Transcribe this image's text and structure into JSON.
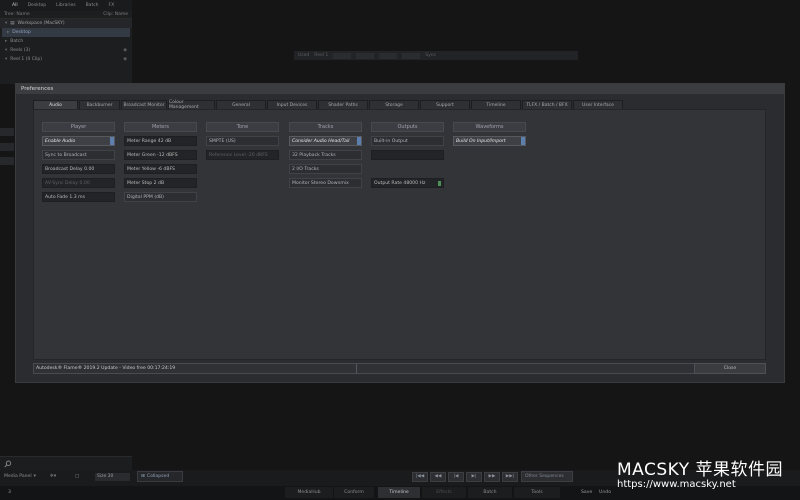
{
  "library": {
    "tabs": [
      "All",
      "Desktop",
      "Libraries",
      "Batch",
      "FX"
    ],
    "tree_label": "Tree: Name",
    "clip_label": "Clip: Name",
    "workspace": "Workspace (MacSKY)",
    "items": [
      "Desktop",
      "Batch",
      "Reels (3)",
      "Reel 1 (0 Clip)"
    ]
  },
  "viewer": {
    "used": "Used",
    "reel": "Reel 1",
    "sync": "Sync"
  },
  "dialog": {
    "title": "Preferences",
    "tabs": [
      "Audio",
      "Backburner",
      "Broadcast Monitor",
      "Colour Management",
      "General",
      "Input Devices",
      "Shader Paths",
      "Storage",
      "Support",
      "Timeline",
      "TLFX / Batch / BFX",
      "User Interface"
    ],
    "active_tab": "Audio",
    "player": {
      "header": "Player",
      "enable_audio": "Enable Audio",
      "sync_broadcast": "Sync to Broadcast",
      "broadcast_delay": "Broadcast Delay 0.00",
      "av_sync_delay": "AV-Sync Delay 0.00",
      "auto_fade": "Auto Fade 1.3 ms"
    },
    "meters": {
      "header": "Meters",
      "range": "Meter Range 42 dB",
      "green": "Meter Green -12 dBFS",
      "yellow": "Meter Yellow -6 dBFS",
      "stop": "Meter Stop 2 dB",
      "ppm": "Digital PPM (dB)"
    },
    "tone": {
      "header": "Tone",
      "standard": "SMPTE (US)",
      "ref_level": "Reference Level -20 dBFS"
    },
    "tracks": {
      "header": "Tracks",
      "consider": "Consider Audio Head/Tail",
      "playback": "32 Playback Tracks",
      "io": "2 I/O Tracks",
      "monitor": "Monitor Stereo Downmix"
    },
    "outputs": {
      "header": "Outputs",
      "builtin": "Built-in Output",
      "rate": "Output Rate 48000 Hz"
    },
    "waveforms": {
      "header": "Waveforms",
      "build": "Build On Input/Import"
    },
    "footer_info": "Autodesk® Flame®   2019.2 Update - Video free 00:17:24:19",
    "close": "Close"
  },
  "bottom": {
    "media_panel": "Media Panel",
    "size": "Size 30",
    "collapsed": "Collapsed",
    "other_sequences": "Other Sequences",
    "page_index": "3",
    "tabs": [
      "MediaHub",
      "Conform",
      "Timeline",
      "Effects",
      "Batch",
      "Tools"
    ],
    "active_tab": "Timeline",
    "save": "Save",
    "undo": "Undo"
  },
  "watermark": {
    "title": "MACSKY 苹果软件园",
    "url": "https://www.macsky.net"
  },
  "colors": {
    "accent": "#5c7fae",
    "status_green": "#4f8f55"
  }
}
